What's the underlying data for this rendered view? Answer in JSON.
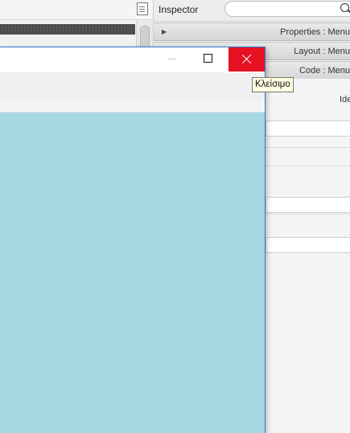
{
  "inspector": {
    "title": "Inspector",
    "search_placeholder": "",
    "sections": [
      {
        "label": "Properties : Menu"
      },
      {
        "label": "Layout : Menu"
      },
      {
        "label": "Code : Menu"
      }
    ],
    "partial_label": "Ide"
  },
  "window": {
    "tooltip": "Κλείσιμο",
    "content_color": "#a6d8e4",
    "close_color": "#e81123"
  },
  "icons": {
    "minimize": "minimize-icon",
    "maximize": "maximize-icon",
    "close": "close-icon",
    "search": "search-icon",
    "document": "document-icon"
  }
}
